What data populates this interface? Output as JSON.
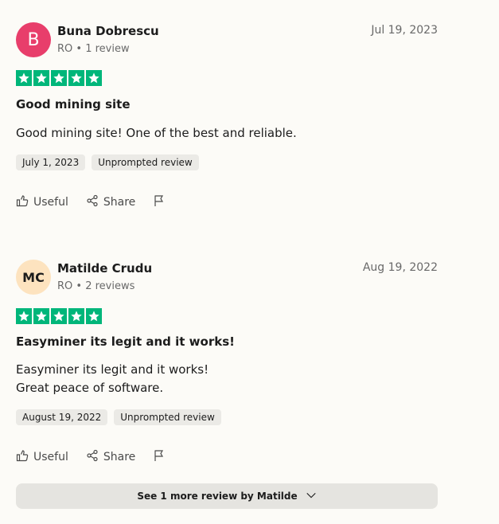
{
  "reviews": [
    {
      "avatar_initials": "B",
      "avatar_color": "#e83e6b",
      "name": "Buna Dobrescu",
      "meta": "RO • 1 review",
      "date": "Jul 19, 2023",
      "stars": 5,
      "title": "Good mining site",
      "body_lines": [
        "Good mining site! One of the best and reliable."
      ],
      "experience_date": "July 1, 2023",
      "tag": "Unprompted review",
      "actions": {
        "useful": "Useful",
        "share": "Share"
      }
    },
    {
      "avatar_initials": "MC",
      "avatar_color": "#fde3bf",
      "name": "Matilde Crudu",
      "meta": "RO • 2 reviews",
      "date": "Aug 19, 2022",
      "stars": 5,
      "title": "Easyminer its legit and it works!",
      "body_lines": [
        "Easyminer its legit and it works!",
        "Great peace of software."
      ],
      "experience_date": "August 19, 2022",
      "tag": "Unprompted review",
      "actions": {
        "useful": "Useful",
        "share": "Share"
      }
    }
  ],
  "more_button": "See 1 more review by Matilde",
  "colors": {
    "star_green": "#00b67a",
    "background": "#fcfbf7"
  }
}
